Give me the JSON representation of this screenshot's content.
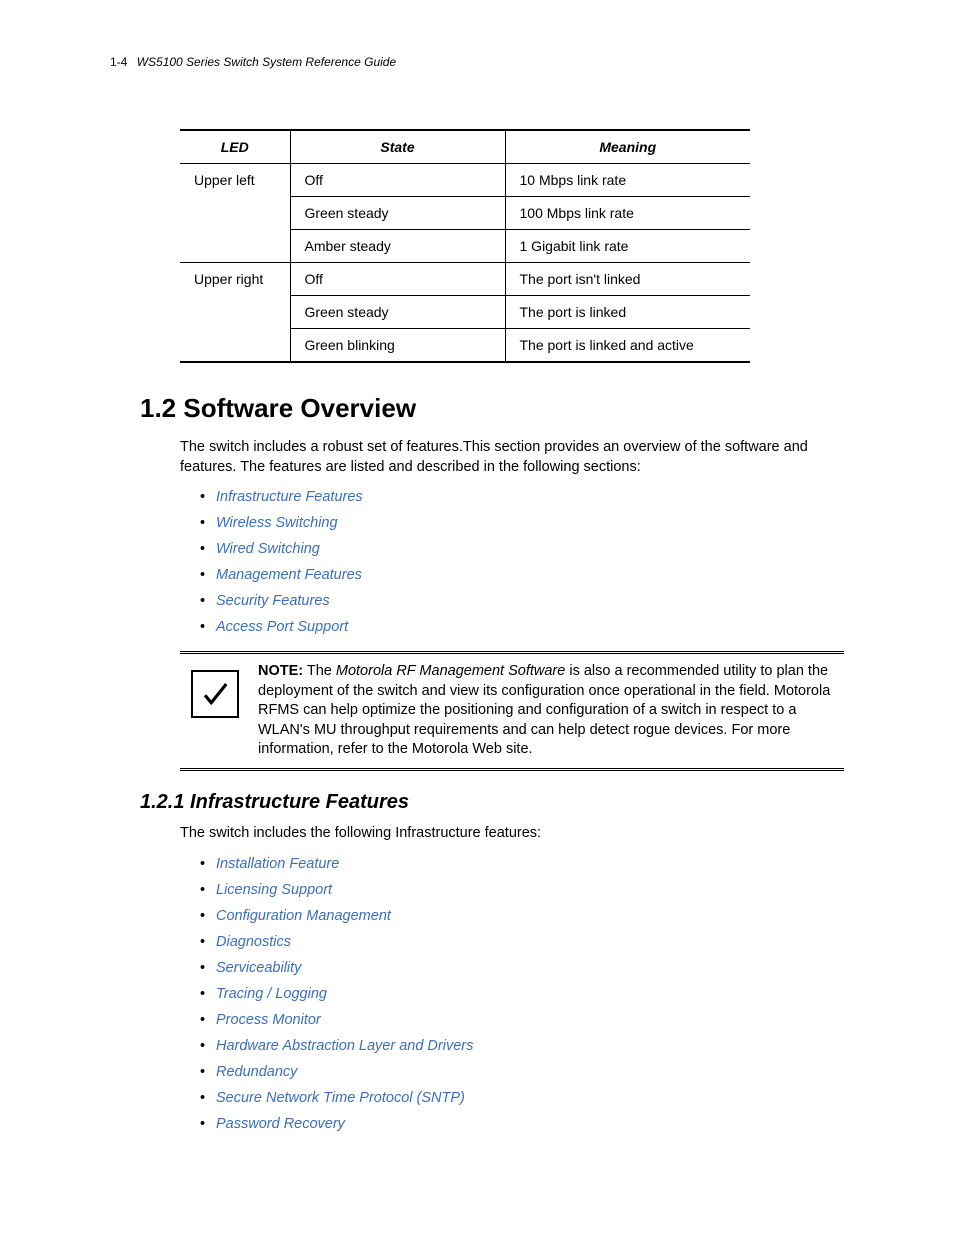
{
  "header": {
    "page_number": "1-4",
    "doc_title": "WS5100 Series Switch System Reference Guide"
  },
  "table": {
    "headers": [
      "LED",
      "State",
      "Meaning"
    ],
    "rows": [
      {
        "led": "Upper left",
        "state": "Off",
        "meaning": "10 Mbps link rate"
      },
      {
        "led": "",
        "state": "Green steady",
        "meaning": "100 Mbps link rate"
      },
      {
        "led": "",
        "state": "Amber steady",
        "meaning": "1 Gigabit link rate"
      },
      {
        "led": "Upper right",
        "state": "Off",
        "meaning": "The port isn't linked"
      },
      {
        "led": "",
        "state": "Green steady",
        "meaning": "The port is linked"
      },
      {
        "led": "",
        "state": "Green blinking",
        "meaning": "The port is linked and active"
      }
    ]
  },
  "section": {
    "number": "1.2",
    "title": "Software Overview",
    "intro": "The switch includes a robust set of features.This section provides an overview of the software and features. The features are listed and described in the following sections:",
    "links": [
      "Infrastructure Features",
      "Wireless Switching",
      "Wired Switching",
      "Management Features",
      "Security Features",
      "Access Port Support"
    ]
  },
  "note": {
    "label": "NOTE:",
    "em": "Motorola RF Management Software",
    "before": " The ",
    "after": " is also a recommended utility to plan the deployment of the switch and view its configuration once operational in the field. Motorola RFMS can help optimize the positioning and configuration of a switch in respect to a WLAN's MU throughput requirements and can help detect rogue devices. For more information, refer to the Motorola Web site."
  },
  "subsection": {
    "number": "1.2.1",
    "title": "Infrastructure Features",
    "intro": "The switch includes the following Infrastructure features:",
    "links": [
      "Installation Feature",
      "Licensing Support",
      "Configuration Management",
      "Diagnostics",
      "Serviceability",
      "Tracing / Logging",
      "Process Monitor",
      "Hardware Abstraction Layer and Drivers",
      "Redundancy",
      "Secure Network Time Protocol (SNTP)",
      "Password Recovery"
    ]
  }
}
